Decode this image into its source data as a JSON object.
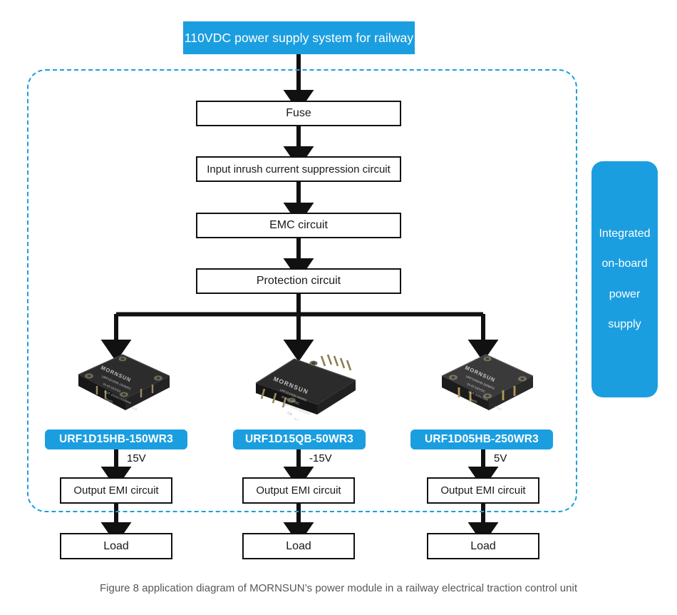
{
  "header": {
    "title": "110VDC power supply system for railway"
  },
  "side_panel": {
    "lines": [
      "Integrated",
      "on-board",
      "power",
      "supply"
    ]
  },
  "chain": [
    {
      "label": "Fuse"
    },
    {
      "label": "Input inrush current suppression circuit"
    },
    {
      "label": "EMC circuit"
    },
    {
      "label": "Protection circuit"
    }
  ],
  "branches": [
    {
      "tag": "URF1D15HB-150WR3",
      "voltage": "15V",
      "output_label": "Output EMI circuit",
      "load_label": "Load",
      "module": {
        "style": "dark-brick",
        "brand": "MORNSUN",
        "model": "URF1D15HB-150WR3",
        "input_line": "IN 43-160VDC",
        "output_line": "OUT 15VDC/X000mA",
        "marks": "RoHS"
      }
    },
    {
      "tag": "URF1D15QB-50WR3",
      "voltage": "-15V",
      "output_label": "Output EMI circuit",
      "load_label": "Load",
      "module": {
        "style": "flat-slab",
        "brand": "MORNSUN",
        "model": "URF1D15QB-50WR3",
        "input_line": "IN 43-160VDC",
        "output_line": "OUT 15VDC/3300mA",
        "marks": "CE RoHS"
      }
    },
    {
      "tag": "URF1D05HB-250WR3",
      "voltage": "5V",
      "output_label": "Output EMI circuit",
      "load_label": "Load",
      "module": {
        "style": "grey-brick",
        "brand": "MORNSUN",
        "model": "URF1D05HB-250WR3",
        "input_line": "IN 43-160VDC",
        "output_line": "OUT 5VDC/50A",
        "marks": "RoHS"
      }
    }
  ],
  "caption": "Figure 8 application diagram of MORNSUN’s power module in a railway electrical traction control unit",
  "colors": {
    "accent_blue": "#1b9ee0",
    "line_black": "#111111",
    "caption_grey": "#595959"
  }
}
